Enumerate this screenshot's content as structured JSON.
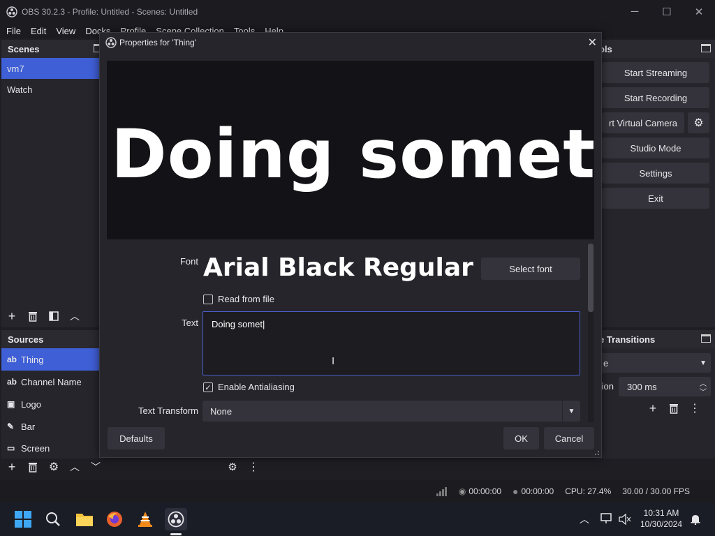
{
  "window": {
    "title": "OBS 30.2.3 - Profile: Untitled - Scenes: Untitled",
    "minimize": "─",
    "maximize": "☐",
    "close": "✕"
  },
  "menu": [
    "File",
    "Edit",
    "View",
    "Docks",
    "Profile",
    "Scene Collection",
    "Tools",
    "Help"
  ],
  "scenes": {
    "header": "Scenes",
    "items": [
      "vm7",
      "Watch"
    ],
    "selected": 0
  },
  "sources": {
    "header": "Sources",
    "items": [
      {
        "icon": "ab",
        "label": "Thing"
      },
      {
        "icon": "ab",
        "label": "Channel Name"
      },
      {
        "icon": "▣",
        "label": "Logo"
      },
      {
        "icon": "✎",
        "label": "Bar"
      },
      {
        "icon": "▭",
        "label": "Screen"
      }
    ],
    "selected": 0
  },
  "controls": {
    "header_fragment": "ols",
    "start_streaming": "Start Streaming",
    "start_recording": "Start Recording",
    "virtual_camera": "rt Virtual Camera",
    "studio_mode": "Studio Mode",
    "settings": "Settings",
    "exit": "Exit"
  },
  "transitions": {
    "header_fragment": "e Transitions",
    "type_fragment": "e",
    "duration_label_fragment": "tion",
    "duration": "300 ms"
  },
  "status": {
    "network_time": "00:00:00",
    "rec_time": "00:00:00",
    "cpu": "CPU: 27.4%",
    "fps": "30.00 / 30.00 FPS"
  },
  "taskbar": {
    "time": "10:31 AM",
    "date": "10/30/2024"
  },
  "dialog": {
    "title": "Properties for 'Thing'",
    "preview_text": "Doing somet",
    "font_label": "Font",
    "font_value": "Arial Black Regular",
    "select_font": "Select font",
    "read_from_file": "Read from file",
    "read_from_file_checked": false,
    "text_label": "Text",
    "text_value": "Doing somet",
    "enable_antialiasing": "Enable Antialiasing",
    "enable_antialiasing_checked": true,
    "text_transform_label": "Text Transform",
    "text_transform_value": "None",
    "defaults": "Defaults",
    "ok": "OK",
    "cancel": "Cancel"
  }
}
